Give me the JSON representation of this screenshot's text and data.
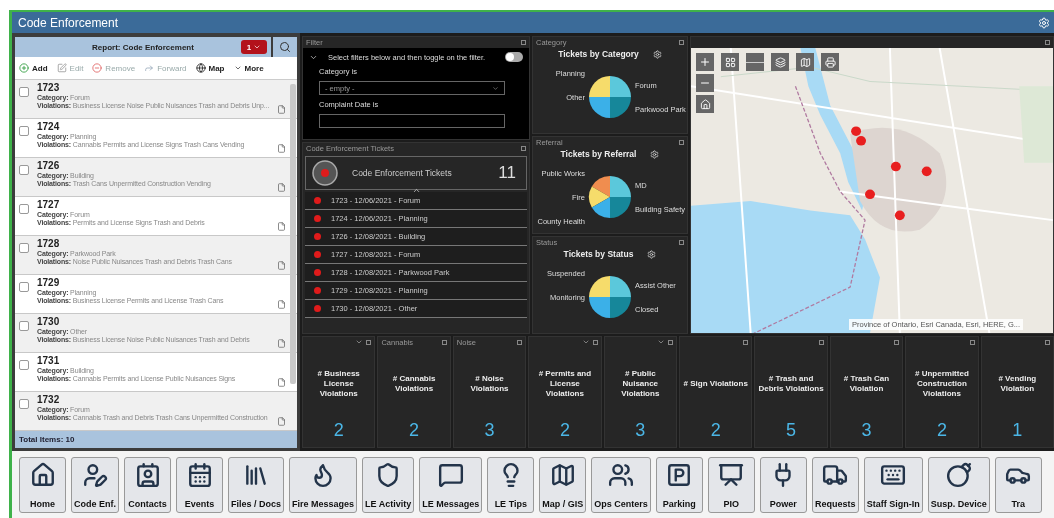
{
  "window": {
    "title": "Code Enforcement"
  },
  "report": {
    "title": "Report: Code Enforcement",
    "badge": "1",
    "toolbar": [
      {
        "kind": "add",
        "label": "Add",
        "disabled": false
      },
      {
        "kind": "edit",
        "label": "Edit",
        "disabled": true
      },
      {
        "kind": "remove",
        "label": "Remove",
        "disabled": true
      },
      {
        "kind": "forward",
        "label": "Forward",
        "disabled": true
      },
      {
        "kind": "map",
        "label": "Map",
        "disabled": false
      },
      {
        "kind": "more",
        "label": "More",
        "disabled": false
      }
    ],
    "items": [
      {
        "id": "1723",
        "category": "**Category:** Forum",
        "violations": "**Violations:** Business License Noise Public Nuisances Trash and Debris Unp...",
        "checked": false
      },
      {
        "id": "1724",
        "category": "**Category:** Planning",
        "violations": "**Violations:** Cannabis Permits and License Signs Trash Cans Vending",
        "checked": false
      },
      {
        "id": "1726",
        "category": "**Category:** Building",
        "violations": "**Violations:** Trash Cans Unpermitted Construction Vending",
        "checked": false
      },
      {
        "id": "1727",
        "category": "**Category:** Forum",
        "violations": "**Violations:** Permits and License Signs Trash and Debris",
        "checked": false
      },
      {
        "id": "1728",
        "category": "**Category:** Parkwood Park",
        "violations": "**Violations:** Noise Public Nuisances Trash and Debris Trash Cans",
        "checked": false
      },
      {
        "id": "1729",
        "category": "**Category:** Planning",
        "violations": "**Violations:** Business License Permits and License Trash Cans",
        "checked": false
      },
      {
        "id": "1730",
        "category": "**Category:** Other",
        "violations": "**Violations:** Business License Noise Public Nuisances Trash and Debris",
        "checked": false
      },
      {
        "id": "1731",
        "category": "**Category:** Building",
        "violations": "**Violations:** Cannabis Permits and License Public Nuisances Signs",
        "checked": false
      },
      {
        "id": "1732",
        "category": "**Category:** Forum",
        "violations": "**Violations:** Cannabis Trash and Debris Trash Cans Unpermitted Construction",
        "checked": false
      }
    ],
    "total": "Total Items: 10"
  },
  "filter": {
    "panel_title": "Filter",
    "instruction": "Select filters below and then toggle on the filter.",
    "on": false,
    "fields": [
      {
        "label": "Category is",
        "value": "- empty -"
      },
      {
        "label": "Complaint Date is"
      }
    ]
  },
  "tickets": {
    "panel_title": "Code Enforcement Tickets",
    "title": "Code Enforcement Tickets",
    "count": "11",
    "rows": [
      "1723 - 12/06/2021 - Forum",
      "1724 - 12/06/2021 - Planning",
      "1726 - 12/08/2021 - Building",
      "1727 - 12/08/2021 - Forum",
      "1728 - 12/08/2021 -  Parkwood Park",
      "1729 - 12/08/2021 - Planning",
      "1730 - 12/08/2021 - Other"
    ]
  },
  "charts": [
    {
      "panel_title": "Category",
      "title": "Tickets by Category",
      "slices": [
        {
          "label": "Planning",
          "color": "#f6dc6b"
        },
        {
          "label": "Forum",
          "color": "#5bc8db"
        },
        {
          "label": "Other",
          "color": "#3bb0e8"
        },
        {
          "label": "Parkwood Park",
          "color": "#16879a"
        }
      ]
    },
    {
      "panel_title": "Referral",
      "title": "Tickets by Referral",
      "slices": [
        {
          "label": "Public Works",
          "color": "#f08d4f"
        },
        {
          "label": "MD",
          "color": "#5bc8db"
        },
        {
          "label": "Fire",
          "color": "#f6dc6b"
        },
        {
          "label": "Building Safety",
          "color": "#16879a"
        },
        {
          "label": "County Health",
          "color": "#3bb0e8"
        }
      ]
    },
    {
      "panel_title": "Status",
      "title": "Tickets by Status",
      "slices": [
        {
          "label": "Suspended",
          "color": "#f6dc6b"
        },
        {
          "label": "Assist Other",
          "color": "#5bc8db"
        },
        {
          "label": "Monitoring",
          "color": "#3bb0e8"
        },
        {
          "label": "Closed",
          "color": "#16879a"
        }
      ]
    }
  ],
  "map": {
    "attribution": "Province of Ontario, Esri Canada, Esri, HERE, G..."
  },
  "tiles": [
    {
      "title": "# Business License Violations",
      "value": "2",
      "dropdown": true
    },
    {
      "panel_title": "Cannabis",
      "title": "# Cannabis Violations",
      "value": "2",
      "dropdown": false
    },
    {
      "panel_title": "Noise",
      "title": "# Noise Violations",
      "value": "3",
      "dropdown": false
    },
    {
      "title": "# Permits and License Violations",
      "value": "2",
      "dropdown": true
    },
    {
      "title": "# Public Nuisance Violations",
      "value": "3",
      "dropdown": true
    },
    {
      "title": "# Sign Violations",
      "value": "2",
      "dropdown": false
    },
    {
      "title": "# Trash and Debris Violations",
      "value": "5",
      "dropdown": false
    },
    {
      "title": "# Trash Can Violation",
      "value": "3",
      "dropdown": false
    },
    {
      "title": "# Unpermitted Construction Violations",
      "value": "2",
      "dropdown": false
    },
    {
      "title": "# Vending Violation",
      "value": "1",
      "dropdown": false
    }
  ],
  "launcher": [
    {
      "kind": "home",
      "label": "Home"
    },
    {
      "kind": "code",
      "label": "Code Enf."
    },
    {
      "kind": "contacts",
      "label": "Contacts"
    },
    {
      "kind": "events",
      "label": "Events"
    },
    {
      "kind": "files",
      "label": "Files / Docs"
    },
    {
      "kind": "fire",
      "label": "Fire Messages"
    },
    {
      "kind": "le_activity",
      "label": "LE Activity"
    },
    {
      "kind": "le_messages",
      "label": "LE Messages"
    },
    {
      "kind": "le_tips",
      "label": "LE Tips"
    },
    {
      "kind": "map",
      "label": "Map / GIS"
    },
    {
      "kind": "ops",
      "label": "Ops Centers"
    },
    {
      "kind": "parking",
      "label": "Parking"
    },
    {
      "kind": "pio",
      "label": "PIO"
    },
    {
      "kind": "power",
      "label": "Power"
    },
    {
      "kind": "requests",
      "label": "Requests"
    },
    {
      "kind": "staff",
      "label": "Staff Sign-In"
    },
    {
      "kind": "device",
      "label": "Susp. Device"
    },
    {
      "kind": "traffic",
      "label": "Tra"
    }
  ]
}
